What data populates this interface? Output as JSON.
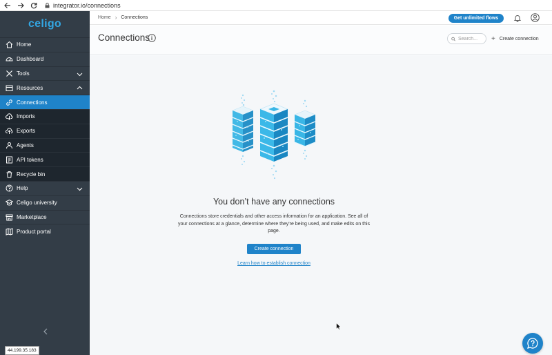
{
  "browser": {
    "url": "integrator.io/connections"
  },
  "sidebar": {
    "logo": "celigo",
    "items": [
      {
        "label": "Home",
        "icon": "home-icon"
      },
      {
        "label": "Dashboard",
        "icon": "dashboard-icon"
      },
      {
        "label": "Tools",
        "icon": "tools-icon",
        "expandable": true
      },
      {
        "label": "Resources",
        "icon": "resources-icon",
        "expanded": true
      },
      {
        "label": "Connections",
        "icon": "connections-icon",
        "active": true
      },
      {
        "label": "Imports",
        "icon": "imports-icon"
      },
      {
        "label": "Exports",
        "icon": "exports-icon"
      },
      {
        "label": "Agents",
        "icon": "agents-icon"
      },
      {
        "label": "API tokens",
        "icon": "api-tokens-icon"
      },
      {
        "label": "Recycle bin",
        "icon": "recycle-bin-icon"
      },
      {
        "label": "Help",
        "icon": "help-icon",
        "expandable": true
      },
      {
        "label": "Celigo university",
        "icon": "university-icon"
      },
      {
        "label": "Marketplace",
        "icon": "marketplace-icon"
      },
      {
        "label": "Product portal",
        "icon": "product-portal-icon"
      }
    ],
    "ip": "44.199.35.183"
  },
  "header": {
    "breadcrumb": [
      "Home",
      "Connections"
    ],
    "cta_label": "Get unlimited flows"
  },
  "page": {
    "title": "Connections",
    "search_placeholder": "Search...",
    "create_label": "Create connection"
  },
  "empty_state": {
    "title": "You don’t have any connections",
    "description": "Connections store credentials and other access information for an application. See all of your connections at a glance, determine where they're being used, and make edits on this page.",
    "button_label": "Create connection",
    "link_label": "Learn how to establish connection"
  },
  "colors": {
    "sidebar_bg": "#333d47",
    "accent": "#1f83c9",
    "logo": "#33a7e4"
  }
}
